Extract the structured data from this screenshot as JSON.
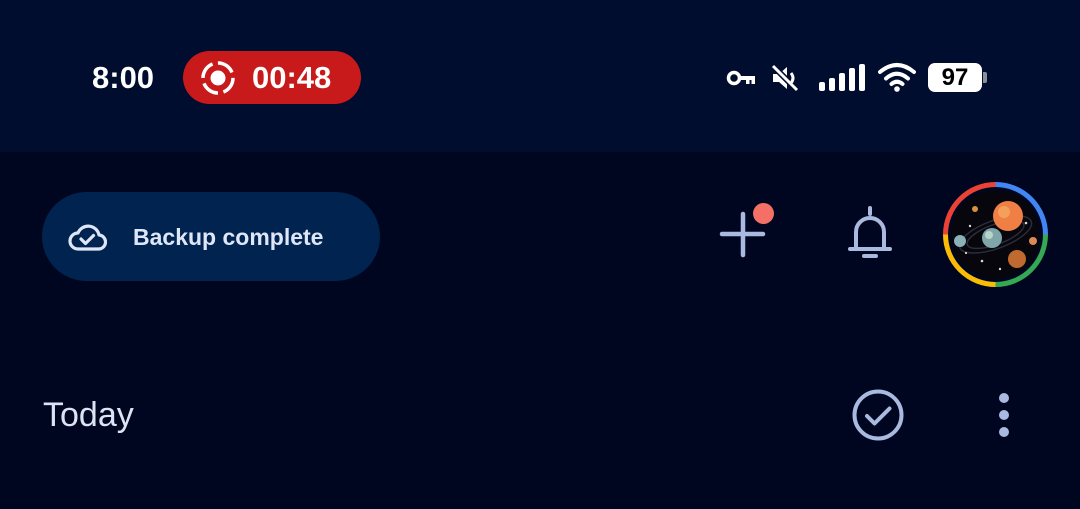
{
  "status_bar": {
    "time": "8:00",
    "recording": {
      "elapsed": "00:48",
      "icon": "screen-record-icon",
      "color": "#c81a1a"
    },
    "icons": [
      "vpn-key-icon",
      "vibrate-off-icon",
      "cellular-signal-icon",
      "wifi-icon"
    ],
    "battery_level": "97"
  },
  "app_bar": {
    "backup_chip": {
      "label": "Backup complete",
      "icon": "cloud-done-icon"
    },
    "add_button_icon": "plus-icon",
    "notification_dot_color": "#f47067",
    "notifications_icon": "bell-icon",
    "avatar_icon": "account-avatar"
  },
  "section": {
    "title": "Today",
    "select_icon": "check-circle-icon",
    "more_icon": "more-vertical-icon"
  },
  "colors": {
    "background": "#00061f",
    "status_bar": "#000d2e",
    "chip": "#00244f",
    "icon_tint": "#a9b9df"
  }
}
